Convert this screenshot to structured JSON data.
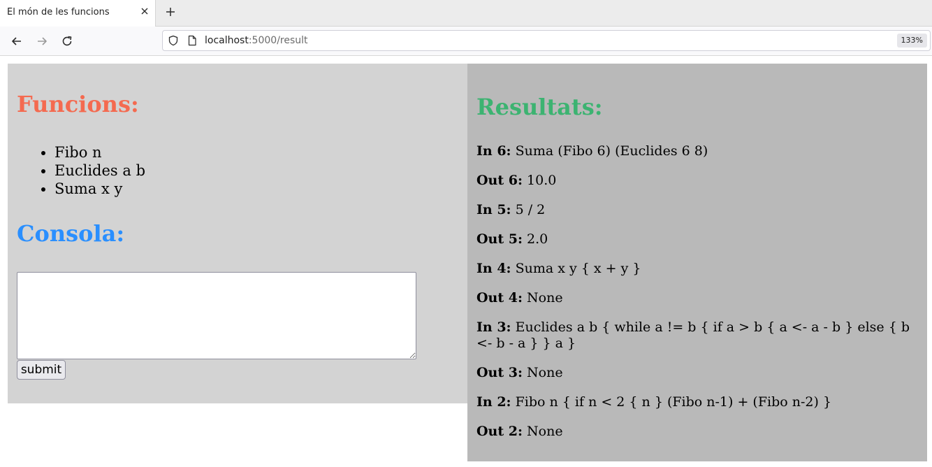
{
  "browser": {
    "tab_title": "El món de les funcions",
    "url_host": "localhost",
    "url_path": ":5000/result",
    "zoom": "133%"
  },
  "left": {
    "funcions_title": "Funcions:",
    "functions": [
      "Fibo n",
      "Euclides a b",
      "Suma x y"
    ],
    "consola_title": "Consola:",
    "submit_label": "submit"
  },
  "right": {
    "resultats_title": "Resultats:",
    "results": [
      {
        "label": "In 6:",
        "text": "Suma (Fibo 6) (Euclides 6 8)"
      },
      {
        "label": "Out 6:",
        "text": "10.0"
      },
      {
        "label": "In 5:",
        "text": "5 / 2"
      },
      {
        "label": "Out 5:",
        "text": "2.0"
      },
      {
        "label": "In 4:",
        "text": "Suma x y { x + y }"
      },
      {
        "label": "Out 4:",
        "text": "None"
      },
      {
        "label": "In 3:",
        "text": "Euclides a b { while a != b { if a > b { a <- a - b } else { b <- b - a } } a }"
      },
      {
        "label": "Out 3:",
        "text": "None"
      },
      {
        "label": "In 2:",
        "text": "Fibo n { if n < 2 { n } (Fibo n-1) + (Fibo n-2) }"
      },
      {
        "label": "Out 2:",
        "text": "None"
      }
    ]
  },
  "colors": {
    "funcions_title": "#f46a50",
    "consola_title": "#2a8fff",
    "resultats_title": "#3cb371",
    "left_panel_bg": "#d3d3d3",
    "right_panel_bg": "#b9b9b9"
  },
  "icons": [
    "close-icon",
    "plus-icon",
    "back-arrow-icon",
    "forward-arrow-icon",
    "reload-icon",
    "shield-icon",
    "page-icon"
  ]
}
